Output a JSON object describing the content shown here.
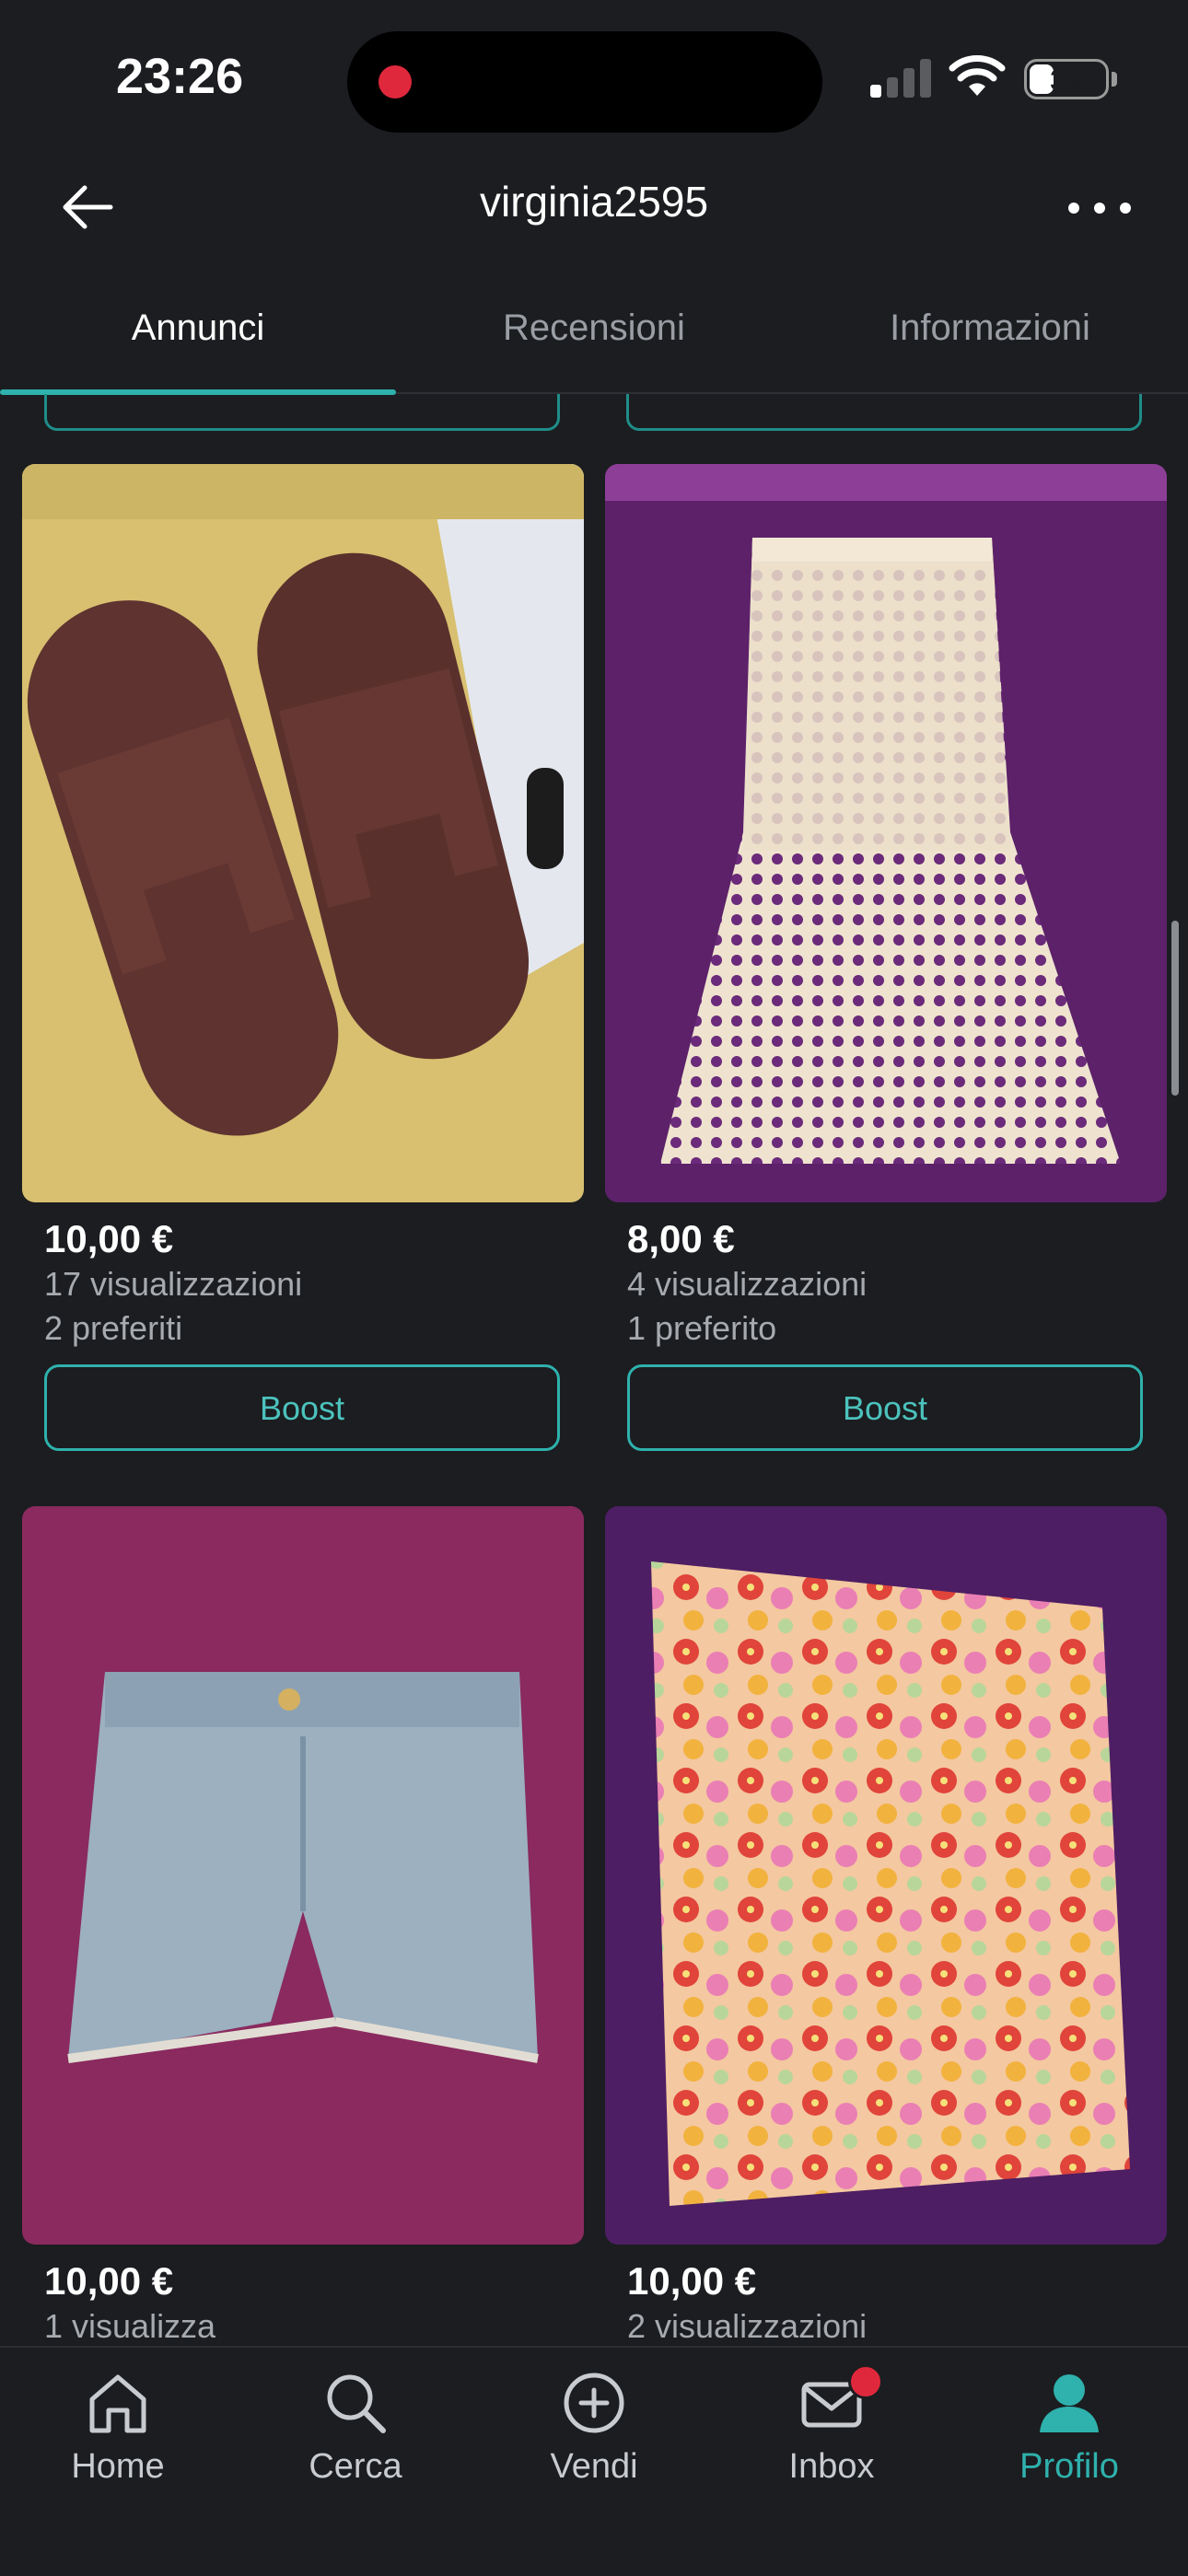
{
  "status_bar": {
    "time": "23:26",
    "battery": "31"
  },
  "header": {
    "title": "virginia2595"
  },
  "tabs": [
    {
      "label": "Annunci",
      "active": true
    },
    {
      "label": "Recensioni",
      "active": false
    },
    {
      "label": "Informazioni",
      "active": false
    }
  ],
  "listings": [
    {
      "price": "10,00 €",
      "views": "17 visualizzazioni",
      "favorites": "2 preferiti",
      "boost_label": "Boost",
      "image": "brown-slide-sandals"
    },
    {
      "price": "8,00 €",
      "views": "4 visualizzazioni",
      "favorites": "1 preferito",
      "boost_label": "Boost",
      "image": "cream-crochet-skirt"
    },
    {
      "price": "10,00 €",
      "views": "1 visualizza",
      "image": "denim-shorts"
    },
    {
      "price": "10,00 €",
      "views": "2 visualizzazioni",
      "image": "floral-skirt"
    }
  ],
  "bottom_nav": [
    {
      "label": "Home",
      "icon": "home-icon"
    },
    {
      "label": "Cerca",
      "icon": "search-icon"
    },
    {
      "label": "Vendi",
      "icon": "plus-circle-icon"
    },
    {
      "label": "Inbox",
      "icon": "mail-icon",
      "badge": true
    },
    {
      "label": "Profilo",
      "icon": "profile-icon",
      "active": true
    }
  ],
  "colors": {
    "background": "#1b1d20",
    "accent": "#2fb1ad",
    "badge": "#e0283c"
  }
}
